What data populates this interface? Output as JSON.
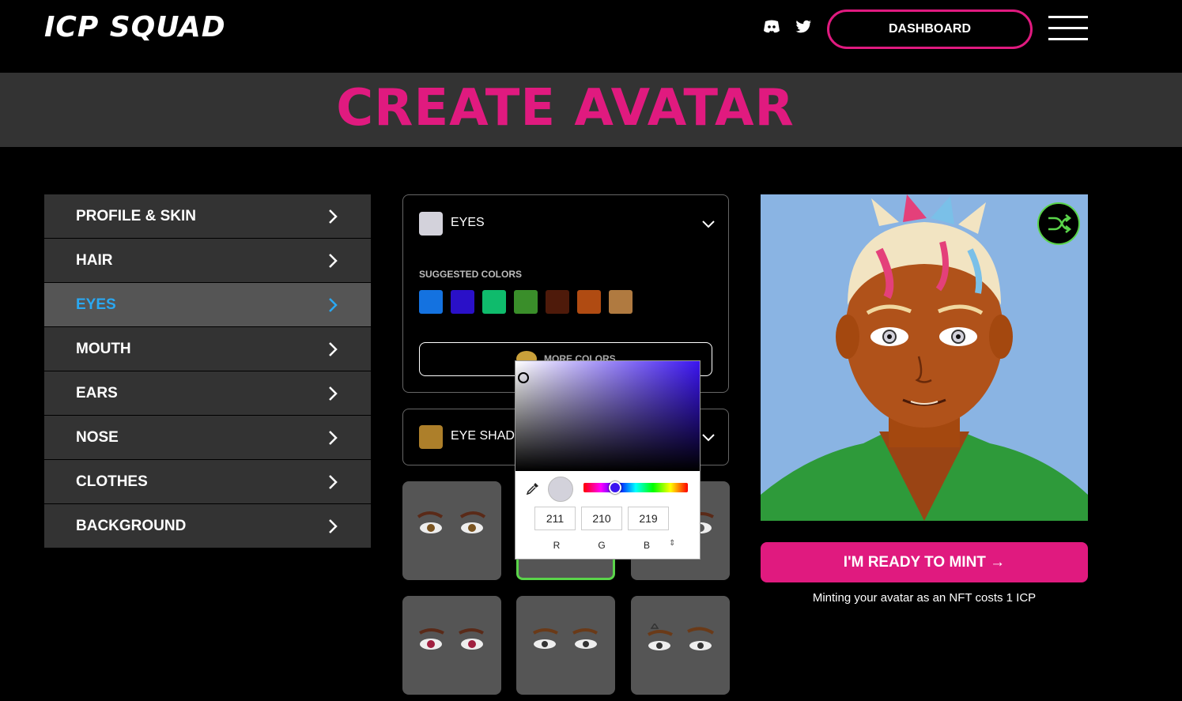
{
  "header": {
    "logo": "ICP SQUAD",
    "discord_icon": "discord-icon",
    "twitter_icon": "twitter-icon",
    "dashboard_label": "DASHBOARD",
    "menu_icon": "hamburger-menu-icon"
  },
  "page": {
    "title": "CREATE AVATAR"
  },
  "sidebar": {
    "items": [
      {
        "label": "PROFILE & SKIN"
      },
      {
        "label": "HAIR"
      },
      {
        "label": "EYES",
        "active": true
      },
      {
        "label": "MOUTH"
      },
      {
        "label": "EARS"
      },
      {
        "label": "NOSE"
      },
      {
        "label": "CLOTHES"
      },
      {
        "label": "BACKGROUND"
      }
    ]
  },
  "eyes_panel": {
    "label": "EYES",
    "swatch_color": "#d3d2db",
    "suggested_title": "SUGGESTED COLORS",
    "suggested_colors": [
      "#1472e0",
      "#2a10c8",
      "#0fbb6c",
      "#3a8e2a",
      "#4e1a0a",
      "#b04b12",
      "#b07a40"
    ],
    "more_colors_label": "MORE COLORS"
  },
  "eye_shadow_panel": {
    "label": "EYE SHADOW",
    "swatch_color": "#ad7f2a"
  },
  "color_picker": {
    "r": "211",
    "g": "210",
    "b": "219",
    "r_label": "R",
    "g_label": "G",
    "b_label": "B",
    "hue_color": "#3a14f0",
    "toggle_glyph": "⇕"
  },
  "eye_tiles": [
    {
      "variant": "eyes-1",
      "selected": false
    },
    {
      "variant": "eyes-2",
      "selected": true
    },
    {
      "variant": "eyes-3",
      "selected": false
    },
    {
      "variant": "eyes-4",
      "selected": false
    },
    {
      "variant": "eyes-5",
      "selected": false
    },
    {
      "variant": "eyes-6",
      "selected": false
    }
  ],
  "avatar": {
    "background_color": "#8ab4e3",
    "shuffle_icon": "shuffle-icon"
  },
  "mint": {
    "button_label": "I'M READY TO MINT →",
    "note": "Minting your avatar as an NFT costs 1 ICP"
  },
  "colors": {
    "accent_pink": "#e01a7f",
    "active_blue": "#2aa8f2",
    "success_green": "#5ad44a"
  }
}
